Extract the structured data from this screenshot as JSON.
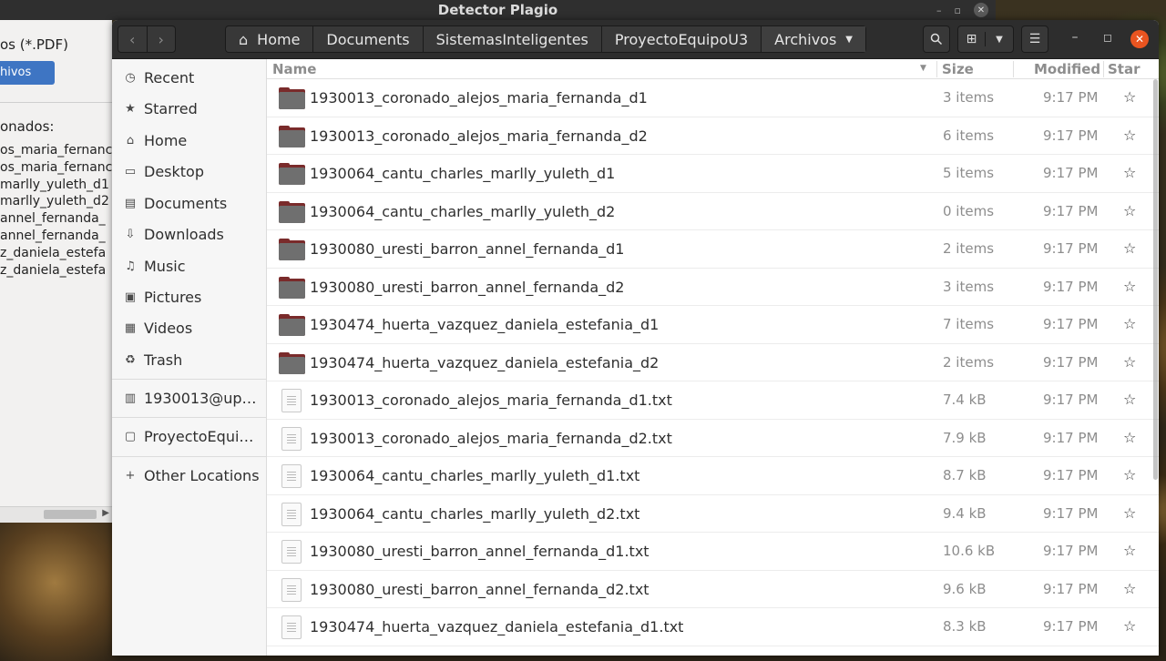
{
  "background_window": {
    "title": "Detector Plagio",
    "filter_text": "os (*.PDF)",
    "button_label": "hivos",
    "selected_label": "onados:",
    "selected_items": [
      "os_maria_fernanc",
      "os_maria_fernanc",
      "marlly_yuleth_d1",
      "marlly_yuleth_d2",
      "annel_fernanda_",
      "annel_fernanda_",
      "z_daniela_estefa",
      "z_daniela_estefa"
    ]
  },
  "header": {
    "path": [
      {
        "label": "Home",
        "icon": "home-icon"
      },
      {
        "label": "Documents"
      },
      {
        "label": "SistemasInteligentes"
      },
      {
        "label": "ProyectoEquipoU3"
      },
      {
        "label": "Archivos",
        "current": true
      }
    ]
  },
  "sidebar": {
    "items": [
      {
        "label": "Recent",
        "icon": "clock-icon"
      },
      {
        "label": "Starred",
        "icon": "star-icon"
      },
      {
        "label": "Home",
        "icon": "home-icon"
      },
      {
        "label": "Desktop",
        "icon": "desktop-icon"
      },
      {
        "label": "Documents",
        "icon": "documents-icon"
      },
      {
        "label": "Downloads",
        "icon": "download-icon"
      },
      {
        "label": "Music",
        "icon": "music-icon"
      },
      {
        "label": "Pictures",
        "icon": "pictures-icon"
      },
      {
        "label": "Videos",
        "icon": "videos-icon"
      },
      {
        "label": "Trash",
        "icon": "trash-icon"
      }
    ],
    "network_drive": "1930013@up…",
    "bookmark": "ProyectoEqui…",
    "other_locations": "Other Locations"
  },
  "columns": {
    "name": "Name",
    "size": "Size",
    "modified": "Modified",
    "star": "Star"
  },
  "files": [
    {
      "name": "1930013_coronado_alejos_maria_fernanda_d1",
      "type": "folder",
      "size": "3 items",
      "modified": "9:17 PM"
    },
    {
      "name": "1930013_coronado_alejos_maria_fernanda_d2",
      "type": "folder",
      "size": "6 items",
      "modified": "9:17 PM"
    },
    {
      "name": "1930064_cantu_charles_marlly_yuleth_d1",
      "type": "folder",
      "size": "5 items",
      "modified": "9:17 PM"
    },
    {
      "name": "1930064_cantu_charles_marlly_yuleth_d2",
      "type": "folder",
      "size": "0 items",
      "modified": "9:17 PM"
    },
    {
      "name": "1930080_uresti_barron_annel_fernanda_d1",
      "type": "folder",
      "size": "2 items",
      "modified": "9:17 PM"
    },
    {
      "name": "1930080_uresti_barron_annel_fernanda_d2",
      "type": "folder",
      "size": "3 items",
      "modified": "9:17 PM"
    },
    {
      "name": "1930474_huerta_vazquez_daniela_estefania_d1",
      "type": "folder",
      "size": "7 items",
      "modified": "9:17 PM"
    },
    {
      "name": "1930474_huerta_vazquez_daniela_estefania_d2",
      "type": "folder",
      "size": "2 items",
      "modified": "9:17 PM"
    },
    {
      "name": "1930013_coronado_alejos_maria_fernanda_d1.txt",
      "type": "file",
      "size": "7.4 kB",
      "modified": "9:17 PM"
    },
    {
      "name": "1930013_coronado_alejos_maria_fernanda_d2.txt",
      "type": "file",
      "size": "7.9 kB",
      "modified": "9:17 PM"
    },
    {
      "name": "1930064_cantu_charles_marlly_yuleth_d1.txt",
      "type": "file",
      "size": "8.7 kB",
      "modified": "9:17 PM"
    },
    {
      "name": "1930064_cantu_charles_marlly_yuleth_d2.txt",
      "type": "file",
      "size": "9.4 kB",
      "modified": "9:17 PM"
    },
    {
      "name": "1930080_uresti_barron_annel_fernanda_d1.txt",
      "type": "file",
      "size": "10.6 kB",
      "modified": "9:17 PM"
    },
    {
      "name": "1930080_uresti_barron_annel_fernanda_d2.txt",
      "type": "file",
      "size": "9.6 kB",
      "modified": "9:17 PM"
    },
    {
      "name": "1930474_huerta_vazquez_daniela_estefania_d1.txt",
      "type": "file",
      "size": "8.3 kB",
      "modified": "9:17 PM"
    }
  ],
  "colors": {
    "accent": "#e95420",
    "folder": "#7a2b2b",
    "header_bg": "#2d2d2d"
  }
}
